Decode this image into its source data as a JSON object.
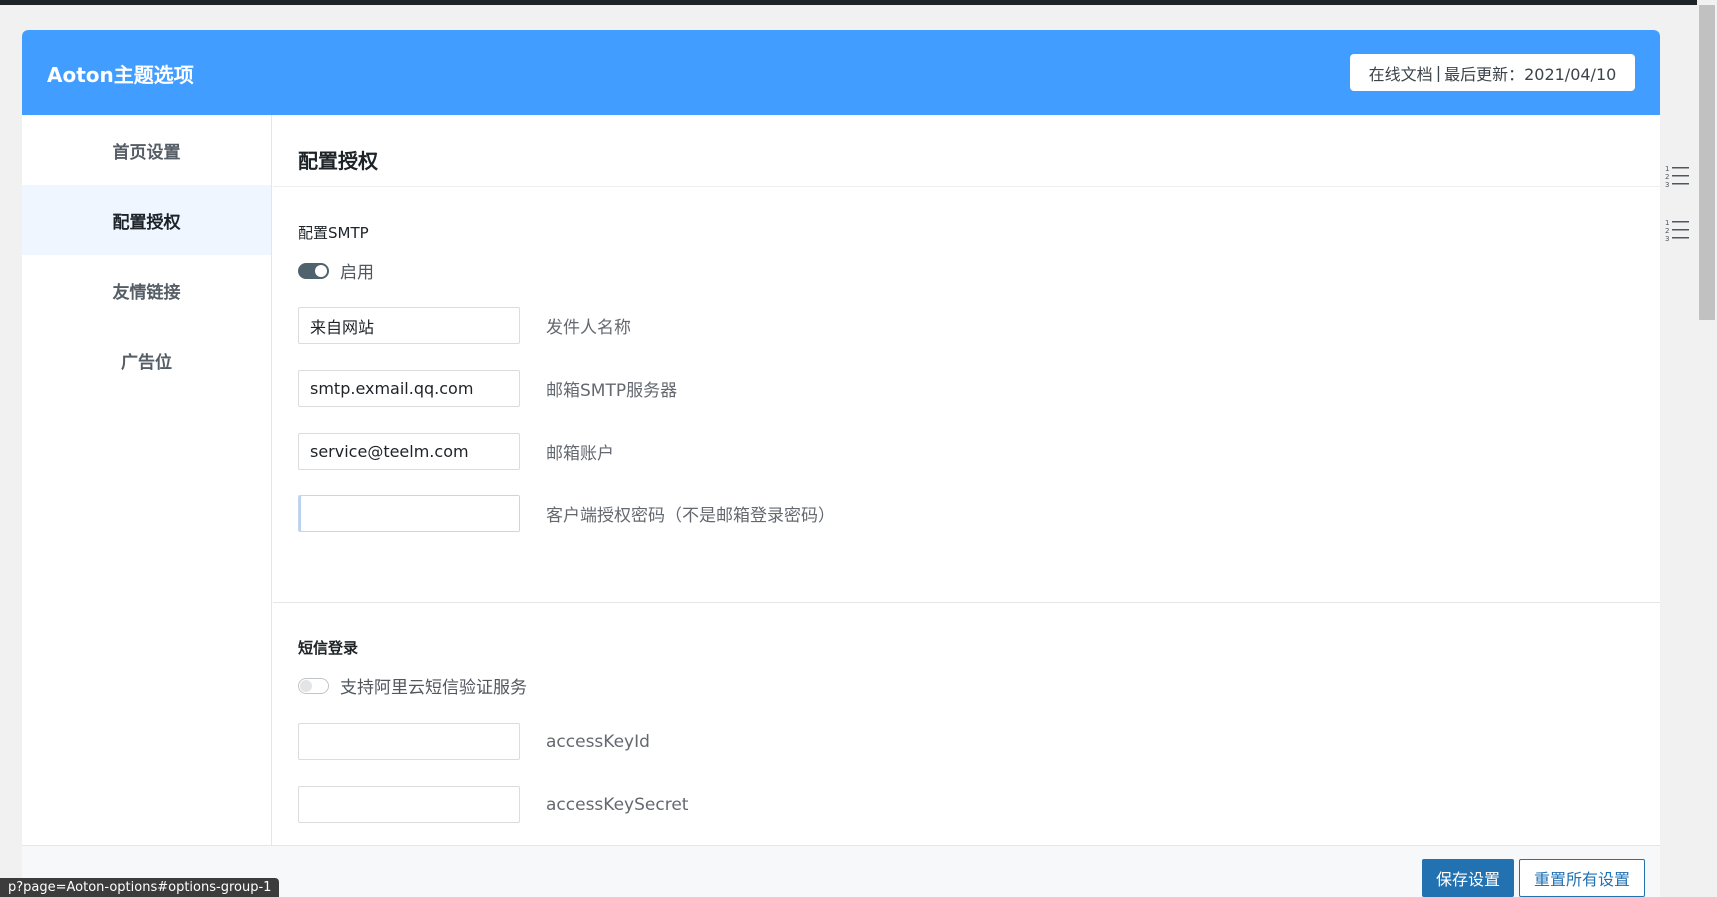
{
  "header": {
    "title": "Aoton主题选项",
    "docs_link": "在线文档",
    "separator": "|",
    "last_update": "最后更新：2021/04/10"
  },
  "sidebar": {
    "items": [
      {
        "label": "首页设置",
        "active": false
      },
      {
        "label": "配置授权",
        "active": true
      },
      {
        "label": "友情链接",
        "active": false
      },
      {
        "label": "广告位",
        "active": false
      }
    ]
  },
  "main": {
    "section_title": "配置授权",
    "smtp": {
      "group_label": "配置SMTP",
      "toggle_label": "启用",
      "toggle_on": true,
      "fields": [
        {
          "value": "来自网站",
          "label": "发件人名称"
        },
        {
          "value": "smtp.exmail.qq.com",
          "label": "邮箱SMTP服务器"
        },
        {
          "value": "service@teelm.com",
          "label": "邮箱账户"
        },
        {
          "value": "",
          "label": "客户端授权密码（不是邮箱登录密码）"
        }
      ]
    },
    "sms": {
      "group_label": "短信登录",
      "toggle_label": "支持阿里云短信验证服务",
      "toggle_on": false,
      "fields": [
        {
          "value": "",
          "label": "accessKeyId"
        },
        {
          "value": "",
          "label": "accessKeySecret"
        }
      ]
    }
  },
  "footer": {
    "save_label": "保存设置",
    "reset_label": "重置所有设置"
  },
  "status_bar": {
    "url": "p?page=Aoton-options#options-group-1"
  },
  "colors": {
    "header_bg": "#419dff",
    "primary_button": "#2271b1",
    "toggle_on": "#50626c"
  },
  "icons": {
    "toc": "numbered-list-icon"
  }
}
